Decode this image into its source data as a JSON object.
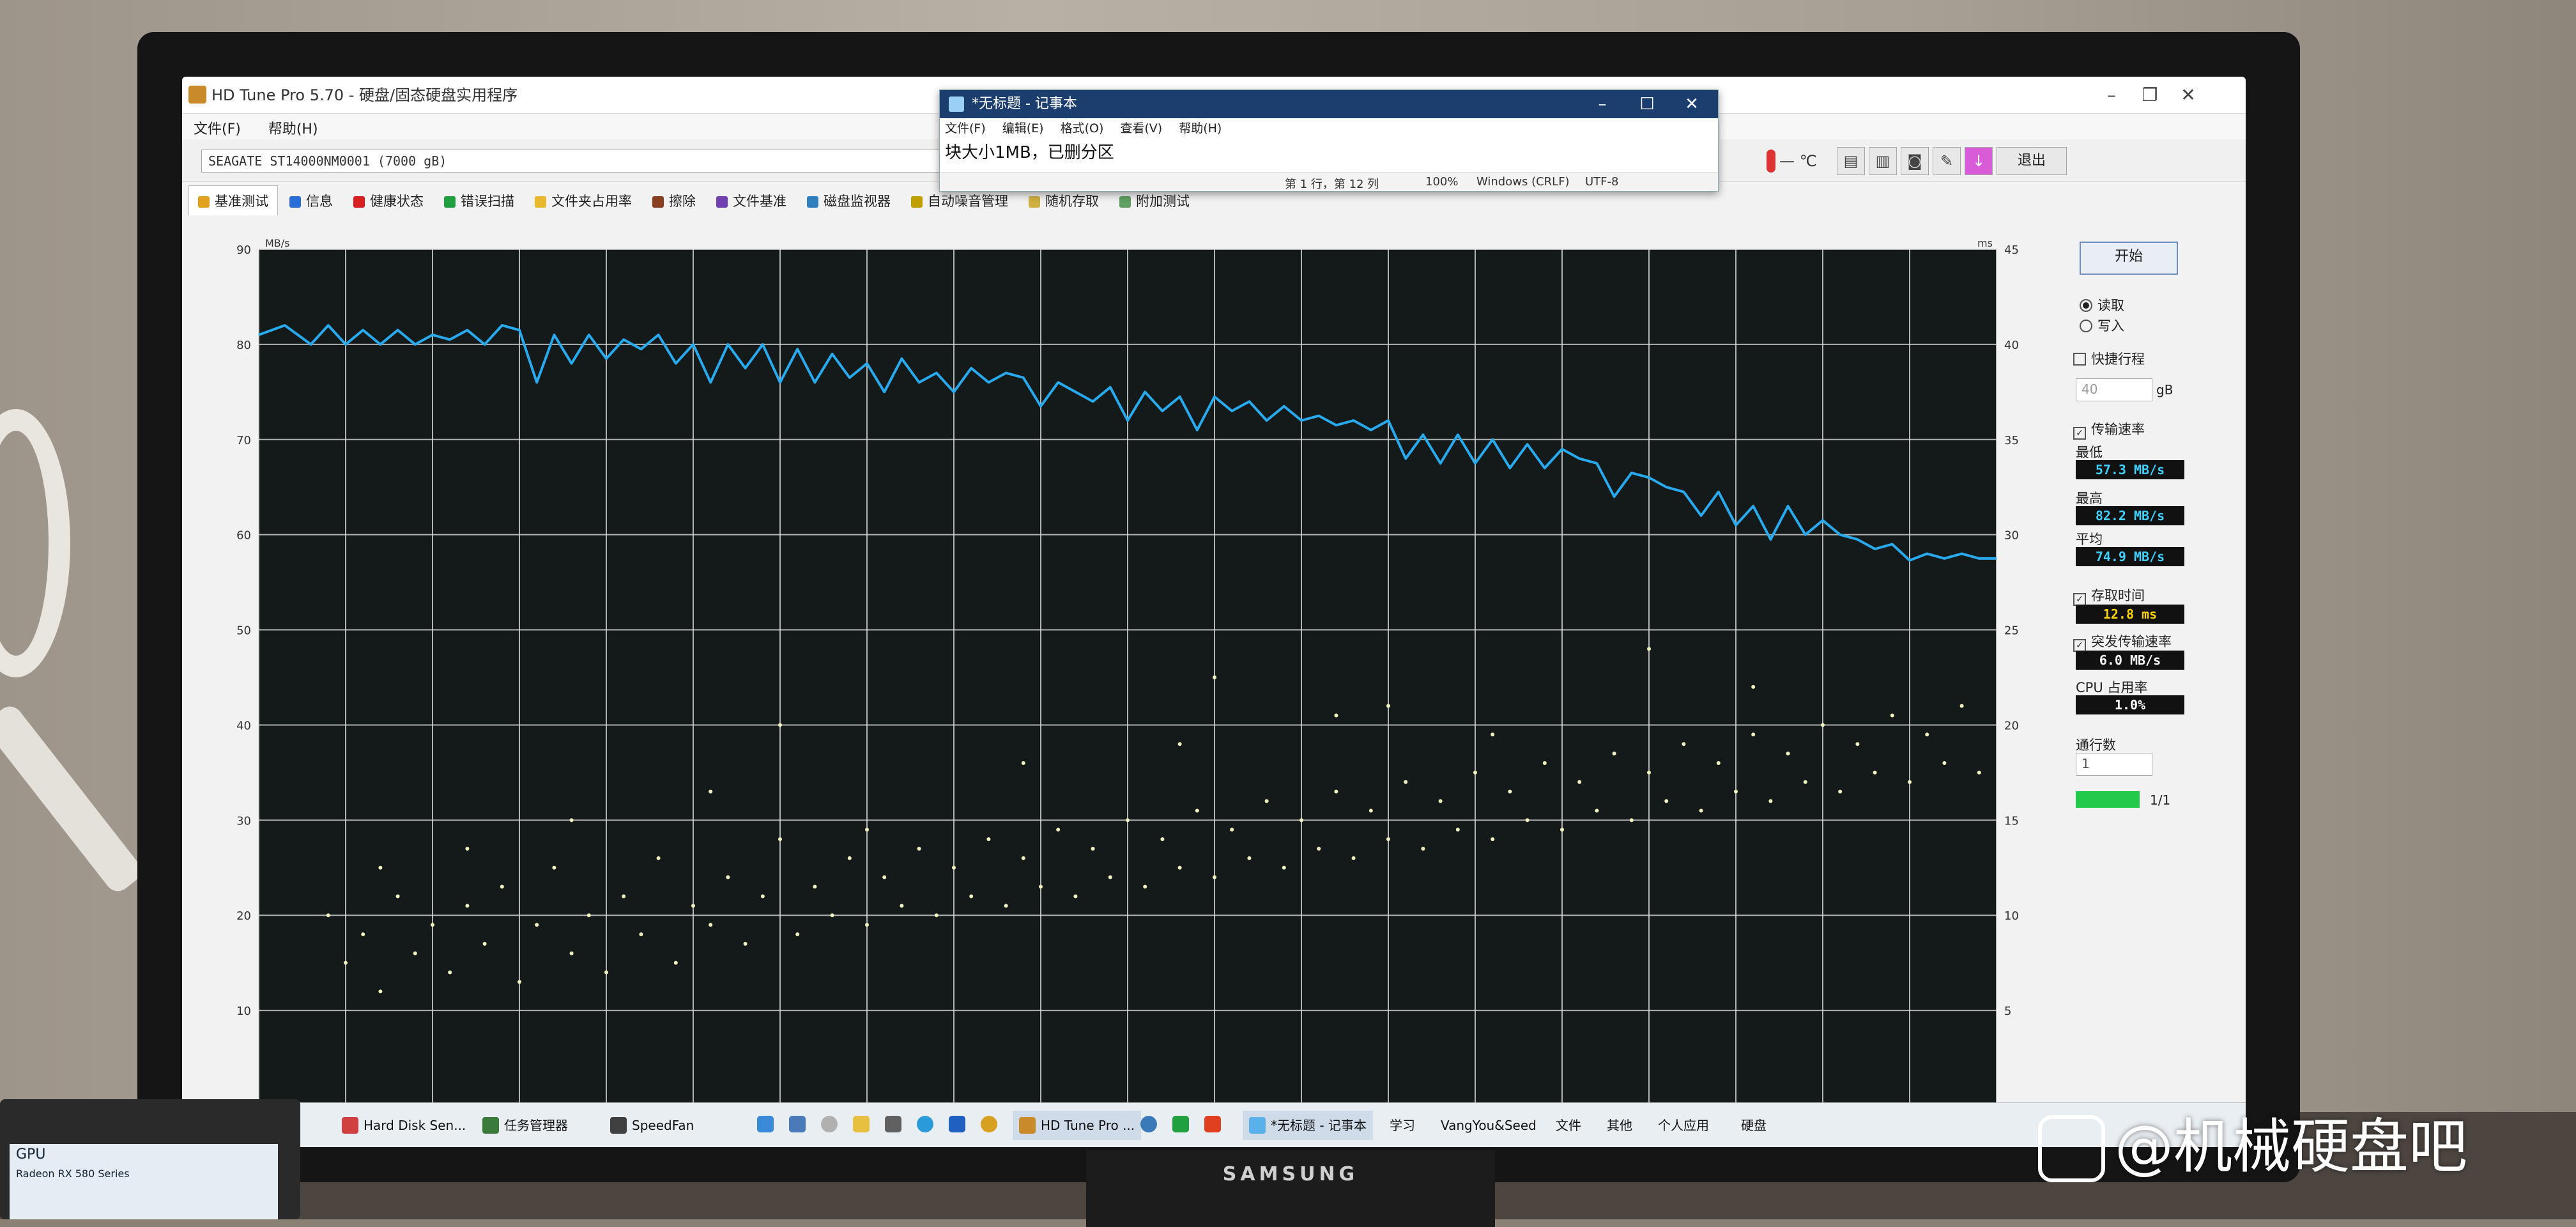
{
  "window": {
    "title": "HD Tune Pro 5.70 - 硬盘/固态硬盘实用程序",
    "menu": [
      "文件(F)",
      "帮助(H)"
    ],
    "drive": "SEAGATE ST14000NM0001 (7000 gB)",
    "temperature": "— ℃",
    "exit_label": "退出",
    "toolbar_icons": [
      "copy-icon",
      "copy-all-icon",
      "screenshot-icon",
      "options-icon",
      "save-icon"
    ]
  },
  "tabs": [
    {
      "label": "基准测试",
      "icon": "benchmark-icon",
      "color": "#e0a020"
    },
    {
      "label": "信息",
      "icon": "info-icon",
      "color": "#2a6ed8"
    },
    {
      "label": "健康状态",
      "icon": "health-icon",
      "color": "#d82020"
    },
    {
      "label": "错误扫描",
      "icon": "error-scan-icon",
      "color": "#20a040"
    },
    {
      "label": "文件夹占用率",
      "icon": "folder-icon",
      "color": "#e8b830"
    },
    {
      "label": "擦除",
      "icon": "erase-icon",
      "color": "#8a4020"
    },
    {
      "label": "文件基准",
      "icon": "file-benchmark-icon",
      "color": "#7040b0"
    },
    {
      "label": "磁盘监视器",
      "icon": "disk-monitor-icon",
      "color": "#3080c0"
    },
    {
      "label": "自动噪音管理",
      "icon": "noise-icon",
      "color": "#c0a000"
    },
    {
      "label": "随机存取",
      "icon": "random-access-icon",
      "color": "#d0b040"
    },
    {
      "label": "附加测试",
      "icon": "extra-tests-icon",
      "color": "#60a060"
    }
  ],
  "panel": {
    "start_label": "开始",
    "read_label": "读取",
    "write_label": "写入",
    "short_stroke_label": "快捷行程",
    "short_stroke_value": "40",
    "short_stroke_unit": "gB",
    "transfer_rate_label": "传输速率",
    "min_label": "最低",
    "min_value": "57.3 MB/s",
    "max_label": "最高",
    "max_value": "82.2 MB/s",
    "avg_label": "平均",
    "avg_value": "74.9 MB/s",
    "access_time_label": "存取时间",
    "access_time_value": "12.8 ms",
    "burst_rate_label": "突发传输速率",
    "burst_rate_value": "6.0 MB/s",
    "cpu_label": "CPU 占用率",
    "cpu_value": "1.0%",
    "passes_label": "通行数",
    "passes_value": "1",
    "progress_label": "1/1",
    "progress_fraction": 1.0
  },
  "notepad": {
    "title": "*无标题 - 记事本",
    "menu": [
      "文件(F)",
      "编辑(E)",
      "格式(O)",
      "查看(V)",
      "帮助(H)"
    ],
    "text": "块大小1MB，已删分区",
    "status_pos": "第 1 行，第 12 列",
    "status_zoom": "100%",
    "status_eol": "Windows (CRLF)",
    "status_enc": "UTF-8"
  },
  "taskbar": {
    "tasks": [
      {
        "label": "Hard Disk Sen...",
        "icon": "hard-disk-sentinel-icon",
        "color": "#d04040"
      },
      {
        "label": "任务管理器",
        "icon": "task-manager-icon",
        "color": "#3a7a3a"
      },
      {
        "label": "SpeedFan",
        "icon": "speedfan-icon",
        "color": "#404040"
      },
      {
        "label": "HD Tune Pro ...",
        "icon": "hdtune-icon",
        "color": "#c98a2a"
      },
      {
        "label": "*无标题 - 记事本",
        "icon": "notepad-icon",
        "color": "#5ab0e8"
      }
    ],
    "toolbars": [
      "学习",
      "VangYou&Seed",
      "文件",
      "其他",
      "个人应用",
      "硬盘"
    ],
    "pinned_icons": [
      "store-icon",
      "explorer-icon",
      "photos-icon",
      "folder-icon",
      "calculator-icon",
      "edge-icon",
      "settings-icon",
      "chrome-icon",
      "browser-icon",
      "plus-icon",
      "office-icon"
    ]
  },
  "monitor_brand": "SAMSUNG",
  "watermark": "@机械硬盘吧",
  "device": {
    "title": "GPU",
    "subtitle": "Radeon RX 580 Series"
  },
  "colors": {
    "chart_bg": "#141a1a",
    "grid": "#d8d8d8",
    "line": "#29a9ee",
    "dots": "#f2f2c0"
  },
  "chart_data": {
    "type": "line",
    "title": "",
    "ylabel": "MB/s",
    "y2label": "ms",
    "ylim": [
      0,
      90
    ],
    "y2lim": [
      0,
      45
    ],
    "yticks": [
      10,
      20,
      30,
      40,
      50,
      60,
      70,
      80,
      90
    ],
    "y2ticks": [
      5,
      10,
      15,
      20,
      25,
      30,
      35,
      40,
      45
    ],
    "xlim": [
      0,
      100
    ],
    "grid": true,
    "series": [
      {
        "x": [
          0,
          1.5,
          3,
          4,
          5,
          6,
          7,
          8,
          9,
          10,
          11,
          12,
          13,
          14,
          15,
          16,
          17,
          18,
          19,
          20,
          21,
          22,
          23,
          24,
          25,
          26,
          27,
          28,
          29,
          30,
          31,
          32,
          33,
          34,
          35,
          36,
          37,
          38,
          39,
          40,
          41,
          42,
          43,
          44,
          45,
          46,
          47,
          48,
          49,
          50,
          51,
          52,
          53,
          54,
          55,
          56,
          57,
          58,
          59,
          60,
          61,
          62,
          63,
          64,
          65,
          66,
          67,
          68,
          69,
          70,
          71,
          72,
          73,
          74,
          75,
          76,
          77,
          78,
          79,
          80,
          81,
          82,
          83,
          84,
          85,
          86,
          87,
          88,
          89,
          90,
          91,
          92,
          93,
          94,
          95,
          96,
          97,
          98,
          99,
          100
        ],
        "y": [
          81,
          82,
          80,
          82,
          80,
          81.5,
          80,
          81.5,
          80,
          81,
          80.5,
          81.5,
          80,
          82,
          81.5,
          76,
          81,
          78,
          81,
          78.5,
          80.5,
          79.5,
          81,
          78,
          80,
          76,
          80,
          77.5,
          80,
          76,
          79.5,
          76,
          79,
          76.5,
          78,
          75,
          78.5,
          76,
          77,
          75,
          77.5,
          76,
          77,
          76.5,
          73.5,
          76,
          75,
          74,
          75.5,
          72,
          75,
          73,
          74.5,
          71,
          74.5,
          73,
          74,
          72,
          73.5,
          72,
          72.5,
          71.5,
          72,
          71,
          72,
          68,
          70.5,
          67.5,
          70.5,
          67.5,
          70,
          67,
          69.5,
          67,
          69,
          68,
          67.5,
          64,
          66.5,
          66,
          65,
          64.5,
          62,
          64.5,
          61,
          63,
          59.5,
          63,
          60,
          61.5,
          60,
          59.5,
          58.5,
          59,
          57.3,
          58,
          57.5,
          58,
          57.5,
          57.5
        ]
      }
    ],
    "access_time_scatter": [
      [
        4,
        20
      ],
      [
        5,
        15
      ],
      [
        6,
        18
      ],
      [
        7,
        12
      ],
      [
        8,
        22
      ],
      [
        9,
        16
      ],
      [
        10,
        19
      ],
      [
        11,
        14
      ],
      [
        12,
        21
      ],
      [
        13,
        17
      ],
      [
        14,
        23
      ],
      [
        15,
        13
      ],
      [
        16,
        19
      ],
      [
        17,
        25
      ],
      [
        18,
        16
      ],
      [
        19,
        20
      ],
      [
        20,
        14
      ],
      [
        21,
        22
      ],
      [
        22,
        18
      ],
      [
        23,
        26
      ],
      [
        24,
        15
      ],
      [
        25,
        21
      ],
      [
        26,
        19
      ],
      [
        27,
        24
      ],
      [
        28,
        17
      ],
      [
        29,
        22
      ],
      [
        30,
        28
      ],
      [
        31,
        18
      ],
      [
        32,
        23
      ],
      [
        33,
        20
      ],
      [
        34,
        26
      ],
      [
        35,
        19
      ],
      [
        36,
        24
      ],
      [
        37,
        21
      ],
      [
        38,
        27
      ],
      [
        39,
        20
      ],
      [
        40,
        25
      ],
      [
        41,
        22
      ],
      [
        42,
        28
      ],
      [
        43,
        21
      ],
      [
        44,
        26
      ],
      [
        45,
        23
      ],
      [
        46,
        29
      ],
      [
        47,
        22
      ],
      [
        48,
        27
      ],
      [
        49,
        24
      ],
      [
        50,
        30
      ],
      [
        51,
        23
      ],
      [
        52,
        28
      ],
      [
        53,
        25
      ],
      [
        54,
        31
      ],
      [
        55,
        24
      ],
      [
        56,
        29
      ],
      [
        57,
        26
      ],
      [
        58,
        32
      ],
      [
        59,
        25
      ],
      [
        60,
        30
      ],
      [
        61,
        27
      ],
      [
        62,
        33
      ],
      [
        63,
        26
      ],
      [
        64,
        31
      ],
      [
        65,
        28
      ],
      [
        66,
        34
      ],
      [
        67,
        27
      ],
      [
        68,
        32
      ],
      [
        69,
        29
      ],
      [
        70,
        35
      ],
      [
        71,
        28
      ],
      [
        72,
        33
      ],
      [
        73,
        30
      ],
      [
        74,
        36
      ],
      [
        75,
        29
      ],
      [
        76,
        34
      ],
      [
        77,
        31
      ],
      [
        78,
        37
      ],
      [
        79,
        30
      ],
      [
        80,
        35
      ],
      [
        81,
        32
      ],
      [
        82,
        38
      ],
      [
        83,
        31
      ],
      [
        84,
        36
      ],
      [
        85,
        33
      ],
      [
        86,
        39
      ],
      [
        87,
        32
      ],
      [
        88,
        37
      ],
      [
        89,
        34
      ],
      [
        90,
        40
      ],
      [
        91,
        33
      ],
      [
        92,
        38
      ],
      [
        93,
        35
      ],
      [
        94,
        41
      ],
      [
        95,
        34
      ],
      [
        96,
        39
      ],
      [
        97,
        36
      ],
      [
        98,
        42
      ],
      [
        99,
        35
      ],
      [
        30,
        40
      ],
      [
        55,
        45
      ],
      [
        65,
        42
      ],
      [
        80,
        48
      ],
      [
        7,
        25
      ],
      [
        12,
        27
      ],
      [
        18,
        30
      ],
      [
        26,
        33
      ],
      [
        35,
        29
      ],
      [
        44,
        36
      ],
      [
        53,
        38
      ],
      [
        62,
        41
      ],
      [
        71,
        39
      ],
      [
        86,
        44
      ]
    ]
  }
}
